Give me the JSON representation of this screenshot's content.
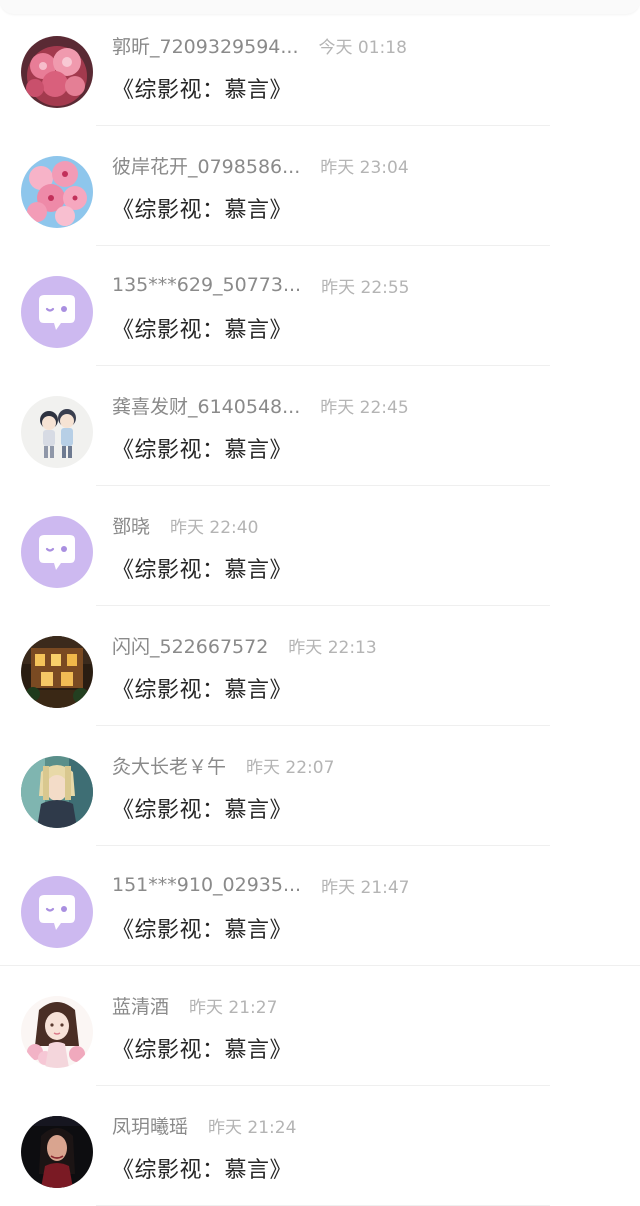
{
  "comments": [
    {
      "name": "郭昕_7209329594...",
      "time": "今天 01:18",
      "text": "《综影视：慕言》",
      "avatar": "pink-flowers-avatar"
    },
    {
      "name": "彼岸花开_0798586...",
      "time": "昨天 23:04",
      "text": "《综影视：慕言》",
      "avatar": "cherry-blossom-avatar"
    },
    {
      "name": "135***629_50773...",
      "time": "昨天 22:55",
      "text": "《综影视：慕言》",
      "avatar": "default-chat-avatar"
    },
    {
      "name": "龚喜发财_6140548...",
      "time": "昨天 22:45",
      "text": "《综影视：慕言》",
      "avatar": "cartoon-couple-avatar"
    },
    {
      "name": "鄧晓",
      "time": "昨天 22:40",
      "text": "《综影视：慕言》",
      "avatar": "default-chat-avatar"
    },
    {
      "name": "闪闪_522667572",
      "time": "昨天 22:13",
      "text": "《综影视：慕言》",
      "avatar": "night-house-avatar"
    },
    {
      "name": "灸大长老￥午",
      "time": "昨天 22:07",
      "text": "《综影视：慕言》",
      "avatar": "anime-character-avatar"
    },
    {
      "name": "151***910_02935...",
      "time": "昨天 21:47",
      "text": "《综影视：慕言》",
      "avatar": "default-chat-avatar"
    },
    {
      "name": "蓝清酒",
      "time": "昨天 21:27",
      "text": "《综影视：慕言》",
      "avatar": "anime-girl-avatar"
    },
    {
      "name": "凤玥曦瑶",
      "time": "昨天 21:24",
      "text": "《综影视：慕言》",
      "avatar": "dark-portrait-avatar"
    }
  ],
  "colors": {
    "name": "#8a8a8a",
    "time": "#b4b4b4",
    "text": "#262626",
    "default_avatar_bg": "#cdb9f0",
    "divider": "#efefef"
  }
}
